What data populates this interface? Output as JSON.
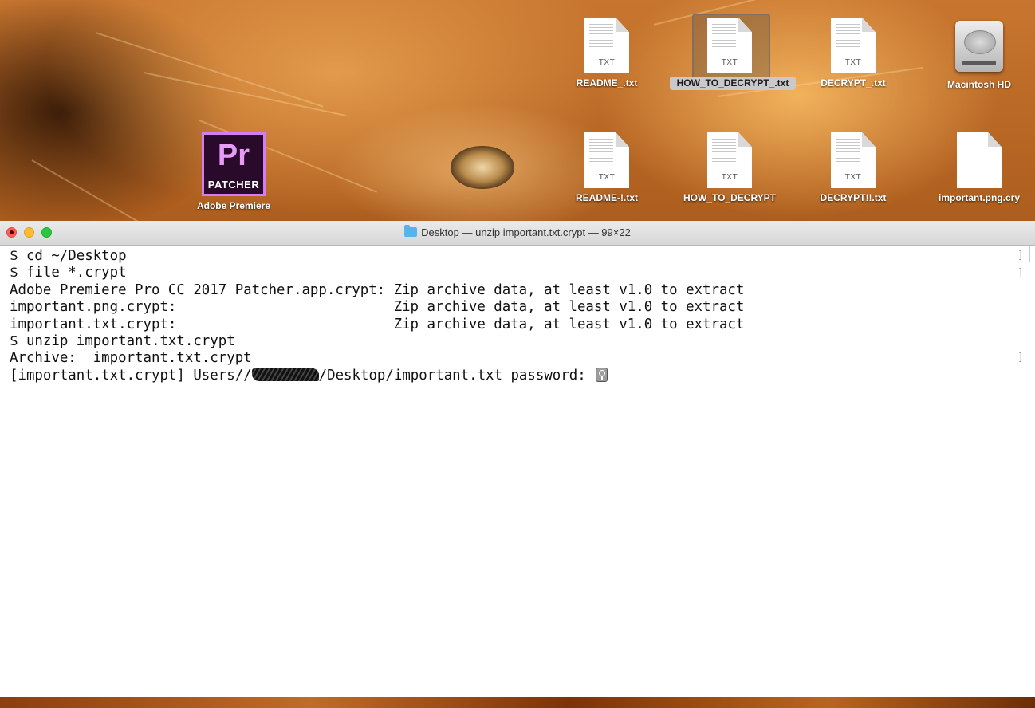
{
  "desktop": {
    "icons": [
      {
        "label": "README_.txt",
        "ext": "TXT"
      },
      {
        "label": "HOW_TO_DECRYPT_.txt",
        "ext": "TXT"
      },
      {
        "label": "DECRYPT_.txt",
        "ext": "TXT"
      },
      {
        "label": "Macintosh HD"
      },
      {
        "label": "Adobe Premiere",
        "app_mark": "Pr",
        "app_sub": "PATCHER"
      },
      {
        "label": "README-!.txt",
        "ext": "TXT"
      },
      {
        "label": "HOW_TO_DECRYPT",
        "ext": "TXT"
      },
      {
        "label": "DECRYPT!!.txt",
        "ext": "TXT"
      },
      {
        "label": "important.png.cry"
      }
    ]
  },
  "terminal": {
    "title": "Desktop — unzip important.txt.crypt — 99×22",
    "lines": [
      "$ cd ~/Desktop",
      "$ file *.crypt",
      "Adobe Premiere Pro CC 2017 Patcher.app.crypt: Zip archive data, at least v1.0 to extract",
      "important.png.crypt:                          Zip archive data, at least v1.0 to extract",
      "important.txt.crypt:                          Zip archive data, at least v1.0 to extract",
      "$ unzip important.txt.crypt",
      "Archive:  important.txt.crypt",
      "[important.txt.crypt] Users//",
      "/Desktop/important.txt password: "
    ]
  },
  "colors": {
    "close": "#fc5f57",
    "minimize": "#fdbc2e",
    "maximize": "#28c83f",
    "folder": "#55b4ea"
  }
}
